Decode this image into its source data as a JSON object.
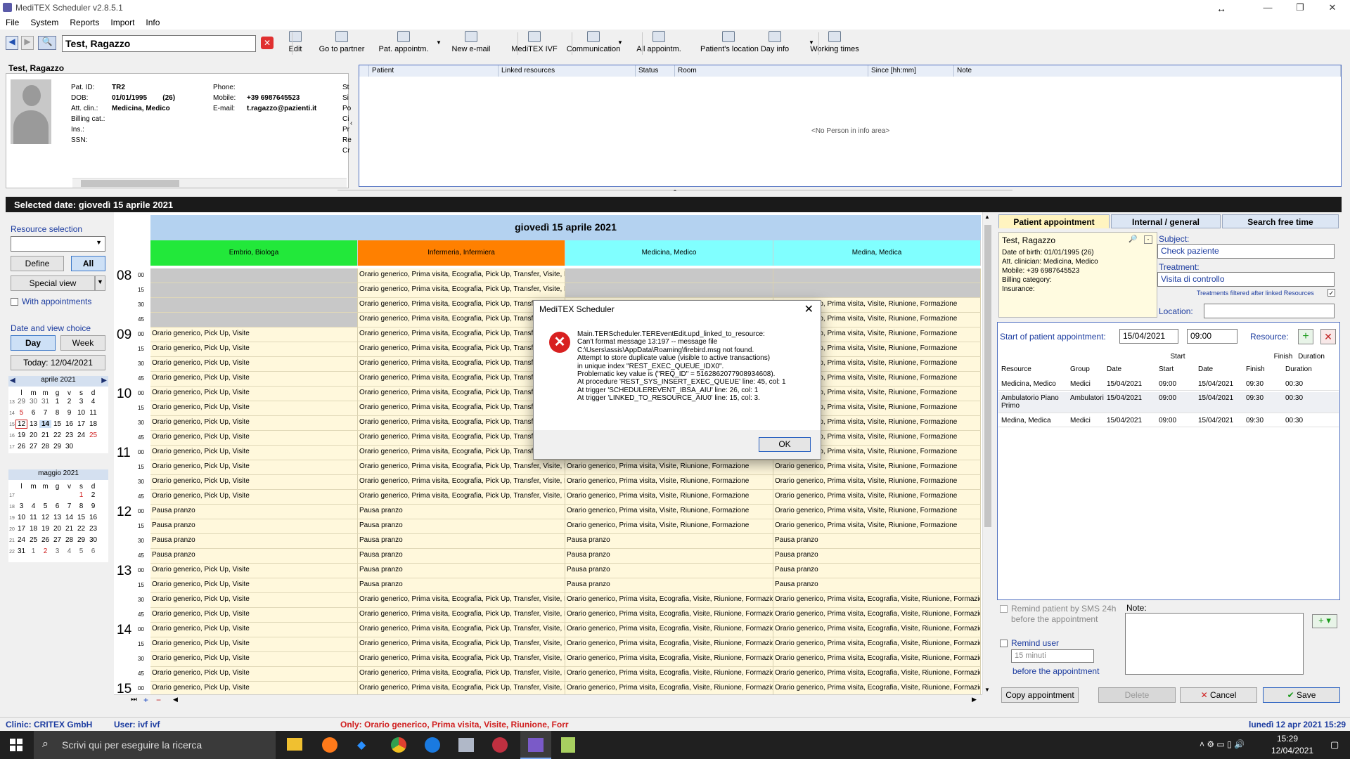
{
  "app": {
    "title": "MediTEX Scheduler  v2.8.5.1"
  },
  "menu": [
    "File",
    "System",
    "Reports",
    "Import",
    "Info"
  ],
  "toolbar": {
    "patient_name": "Test, Ragazzo",
    "buttons": [
      "Edit",
      "Go to partner",
      "Pat. appointm.",
      "New e-mail",
      "MediTEX IVF",
      "Communication",
      "All appointm.",
      "Patient's location",
      "Day info",
      "Working times"
    ]
  },
  "patient": {
    "header": "Test, Ragazzo",
    "labels": [
      "Pat. ID:",
      "DOB:",
      "Att. clin.:",
      "Billing cat.:",
      "Ins.:",
      "SSN:"
    ],
    "values": [
      "TR2",
      "01/01/1995        (26)",
      "Medicina, Medico",
      "",
      "",
      ""
    ],
    "contact_labels": [
      "Phone:",
      "Mobile:",
      "E-mail:"
    ],
    "contact_values": [
      "",
      "+39 6987645523",
      "t.ragazzo@pazienti.it"
    ],
    "side_letters": [
      "St",
      "Si",
      "Po",
      "Ci",
      "Pr",
      "Re",
      "Cr"
    ]
  },
  "info_table": {
    "columns": [
      "Patient",
      "Linked resources",
      "Status",
      "Room",
      "Since [hh:mm]",
      "Note"
    ],
    "empty": "<No Person in info area>"
  },
  "selected_date": "Selected date:  giovedì 15 aprile 2021",
  "left": {
    "resource_selection": "Resource selection",
    "define": "Define",
    "all": "All",
    "special_view": "Special view",
    "with_appointments": "With appointments",
    "date_view": "Date and view choice",
    "day": "Day",
    "week": "Week",
    "today": "Today: 12/04/2021",
    "cal1_title": "aprile 2021",
    "cal2_title": "maggio 2021",
    "weekdays": [
      "l",
      "m",
      "m",
      "g",
      "v",
      "s",
      "d"
    ],
    "cal1": [
      [
        "13",
        "29",
        "30",
        "31",
        "1",
        "2",
        "3",
        "4"
      ],
      [
        "14",
        "5",
        "6",
        "7",
        "8",
        "9",
        "10",
        "11"
      ],
      [
        "15",
        "12",
        "13",
        "14",
        "15",
        "16",
        "17",
        "18"
      ],
      [
        "16",
        "19",
        "20",
        "21",
        "22",
        "23",
        "24",
        "25"
      ],
      [
        "17",
        "26",
        "27",
        "28",
        "29",
        "30",
        "",
        ""
      ]
    ],
    "cal2": [
      [
        "17",
        "",
        "",
        "",
        "",
        "",
        "1",
        "2"
      ],
      [
        "18",
        "3",
        "4",
        "5",
        "6",
        "7",
        "8",
        "9"
      ],
      [
        "19",
        "10",
        "11",
        "12",
        "13",
        "14",
        "15",
        "16"
      ],
      [
        "20",
        "17",
        "18",
        "19",
        "20",
        "21",
        "22",
        "23"
      ],
      [
        "21",
        "24",
        "25",
        "26",
        "27",
        "28",
        "29",
        "30"
      ],
      [
        "22",
        "31",
        "1",
        "2",
        "3",
        "4",
        "5",
        "6"
      ]
    ]
  },
  "schedule": {
    "day_title": "giovedì 15 aprile 2021",
    "columns": [
      "Embrio, Biologa",
      "Infermeria, Infermiera",
      "Medicina, Medico",
      "Medina, Medica"
    ],
    "column_colors": [
      "#22e83a",
      "#ff8000",
      "#80ffff",
      "#80ffff"
    ],
    "hours": [
      "08",
      "09",
      "10",
      "11",
      "12",
      "13",
      "14",
      "15"
    ],
    "minutes": [
      "00",
      "15",
      "30",
      "45"
    ],
    "t_gen": "Orario generico, Pick Up, Visite",
    "t_inf": "Orario generico, Prima visita, Ecografia, Pick Up, Transfer, Visite, Riunione, Formazione",
    "t_med1": "Orario generico, Prima visita, Visite, Riunione, Formazione",
    "t_med2": "Orario generico, Prima visita, Ecografia, Visite, Riunione, Formazione",
    "t_pausa": "Pausa pranzo"
  },
  "tabs": [
    "Patient appointment",
    "Internal / general",
    "Search free time"
  ],
  "appt": {
    "name": "Test, Ragazzo",
    "details": [
      "Date of birth: 01/01/1995 (26)",
      "Att. clinician: Medicina, Medico",
      "Mobile: +39 6987645523",
      "Billing category:",
      "Insurance:"
    ],
    "subject_label": "Subject:",
    "subject": "Check paziente",
    "treatment_label": "Treatment:",
    "treatment": "Visita di controllo",
    "filter_note": "Treatments filtered after linked Resources",
    "location_label": "Location:",
    "start_label": "Start of patient appointment:",
    "start_date": "15/04/2021",
    "start_time": "09:00",
    "resource_label": "Resource:",
    "grid_groups": [
      "Start",
      "Finish",
      "Duration"
    ],
    "grid_cols": [
      "Resource",
      "Group",
      "Date",
      "Start",
      "Date",
      "Finish",
      "Duration"
    ],
    "rows": [
      [
        "Medicina, Medico",
        "Medici",
        "15/04/2021",
        "09:00",
        "15/04/2021",
        "09:30",
        "00:30"
      ],
      [
        "Ambulatorio Piano Primo",
        "Ambulatori",
        "15/04/2021",
        "09:00",
        "15/04/2021",
        "09:30",
        "00:30"
      ],
      [
        "Medina, Medica",
        "Medici",
        "15/04/2021",
        "09:00",
        "15/04/2021",
        "09:30",
        "00:30"
      ]
    ],
    "remind_sms": "Remind patient by SMS 24h",
    "before_appt": "before the appointment",
    "remind_user": "Remind user",
    "remind_value": "15 minuti",
    "before_appt2": "before the appointment",
    "note_label": "Note:",
    "copy": "Copy appointment",
    "delete": "Delete",
    "cancel": "Cancel",
    "save": "Save"
  },
  "status": {
    "clinic": "Clinic: CRITEX GmbH",
    "user": "User: ivf ivf",
    "only": "Only: Orario generico, Prima visita, Visite, Riunione, Forr",
    "datetime": "lunedì 12 apr 2021 15:29"
  },
  "dialog": {
    "title": "MediTEX Scheduler",
    "lines": [
      "Main.TERScheduler.TEREventEdit.upd_linked_to_resource:",
      "Can't format message 13:197 -- message file",
      "C:\\Users\\assis\\AppData\\Roaming\\firebird.msg not found.",
      "Attempt to store duplicate value (visible to active transactions)",
      "in unique index \"REST_EXEC_QUEUE_IDX0\".",
      "Problematic key value is (\"REQ_ID\" = 5162862077908934608).",
      "At procedure 'REST_SYS_INSERT_EXEC_QUEUE' line: 45, col: 1",
      "At trigger 'SCHEDULEREVENT_IBSA_AIU' line: 26, col: 1",
      "At trigger 'LINKED_TO_RESOURCE_AIU0' line: 15, col: 3."
    ],
    "ok": "OK"
  },
  "taskbar": {
    "search": "Scrivi qui per eseguire la ricerca",
    "time": "15:29",
    "date": "12/04/2021"
  }
}
